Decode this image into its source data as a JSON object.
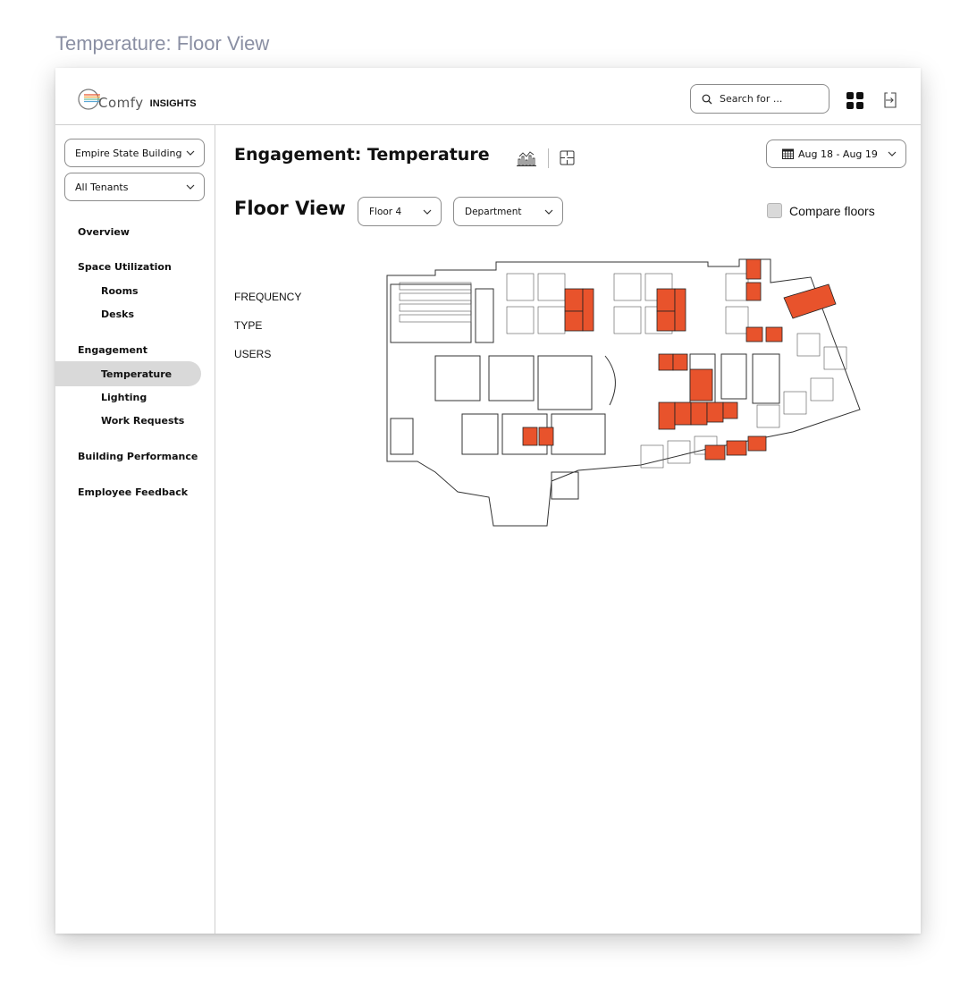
{
  "page_caption": "Temperature: Floor View",
  "brand": {
    "logo_text": "Comfy",
    "product": "INSIGHTS"
  },
  "topbar": {
    "search_placeholder": "Search for ..."
  },
  "sidebar": {
    "building": "Empire State Building",
    "tenant": "All Tenants",
    "nav": {
      "overview": "Overview",
      "space_utilization": "Space Utilization",
      "rooms": "Rooms",
      "desks": "Desks",
      "engagement": "Engagement",
      "temperature": "Temperature",
      "lighting": "Lighting",
      "work_requests": "Work Requests",
      "building_performance": "Building Performance",
      "employee_feedback": "Employee Feedback"
    },
    "active_item": "Temperature"
  },
  "main": {
    "title": "Engagement: Temperature",
    "date_range": "Aug 18 - Aug 19",
    "section_title": "Floor View",
    "floor_select": "Floor 4",
    "department_select": "Department",
    "compare_label": "Compare floors",
    "compare_checked": false,
    "filters": [
      "FREQUENCY",
      "TYPE",
      "USERS"
    ]
  },
  "colors": {
    "highlight": "#e8532c",
    "caption": "#8a8fa3",
    "active_bg": "#d9d9d9",
    "border": "#8c8c8c"
  },
  "icons": [
    "search-icon",
    "apps-grid-icon",
    "exit-icon",
    "chevron-down-icon",
    "chart-icon",
    "floorplan-icon",
    "calendar-icon"
  ]
}
